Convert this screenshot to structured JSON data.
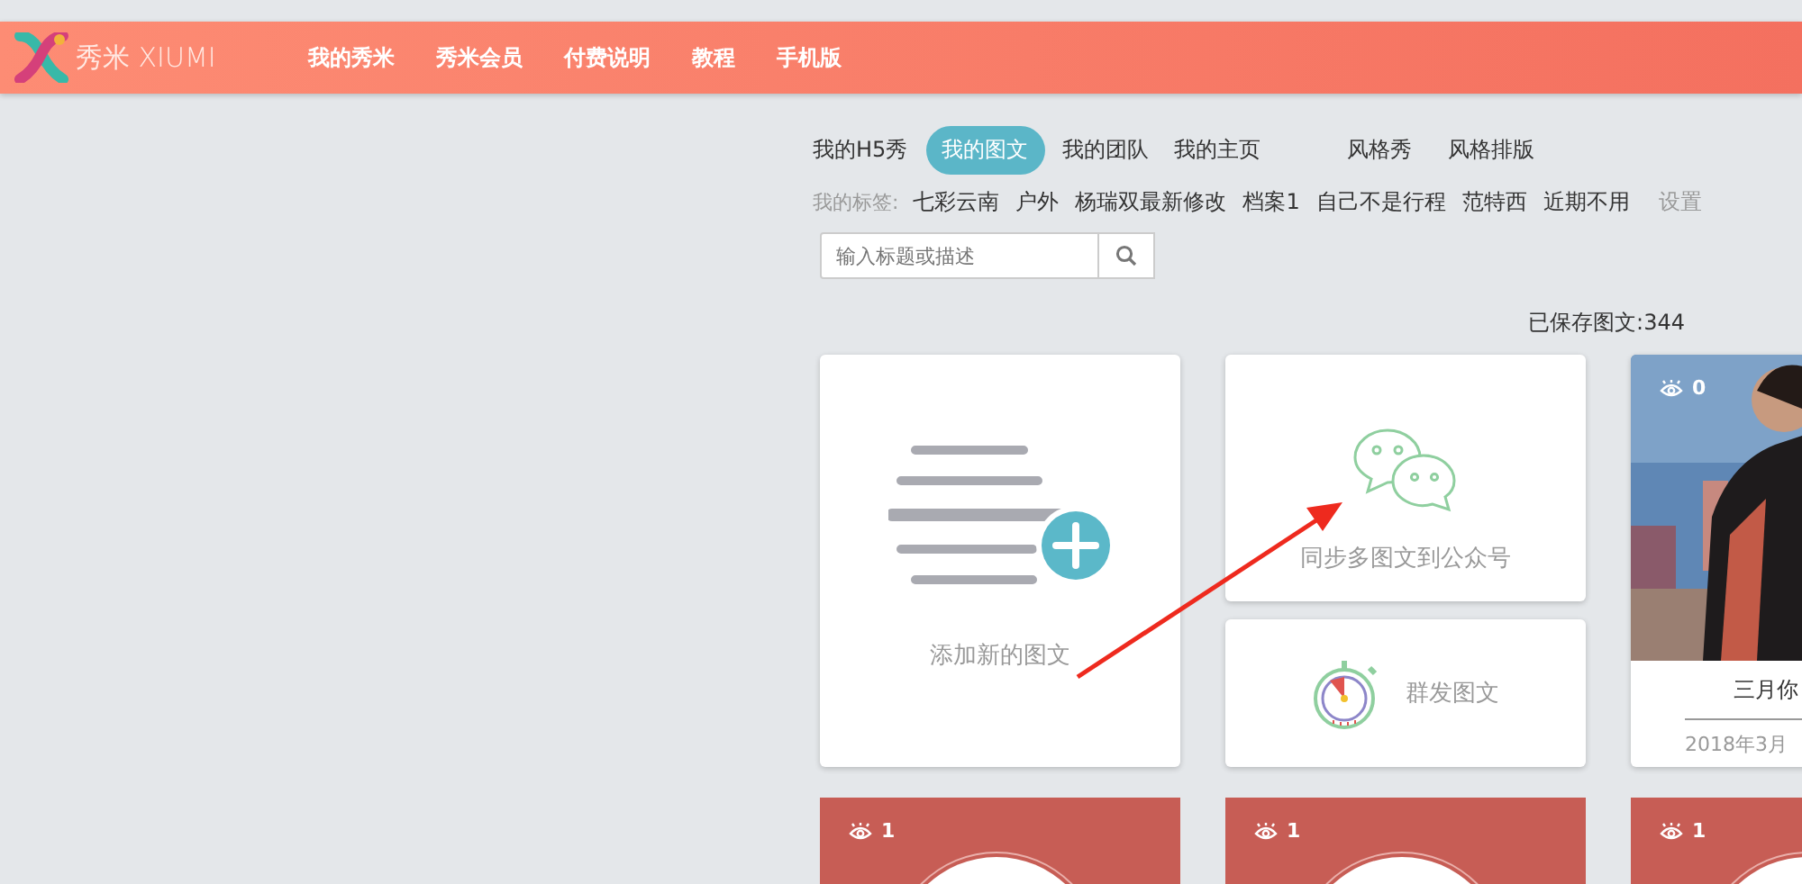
{
  "header": {
    "logo": "秀米 XIUMI",
    "nav": [
      "我的秀米",
      "秀米会员",
      "付费说明",
      "教程",
      "手机版"
    ]
  },
  "tabs": [
    {
      "label": "我的H5秀",
      "selected": false
    },
    {
      "label": "我的图文",
      "selected": true
    },
    {
      "label": "我的团队",
      "selected": false
    },
    {
      "label": "我的主页",
      "selected": false
    }
  ],
  "style_links": [
    "风格秀",
    "风格排版"
  ],
  "tags": {
    "label": "我的标签:",
    "items": [
      "七彩云南",
      "户外",
      "杨瑞双最新修改",
      "档案1",
      "自己不是行程",
      "范特西",
      "近期不用"
    ],
    "settings": "设置"
  },
  "search": {
    "placeholder": "输入标题或描述"
  },
  "saved_count": "已保存图文:344",
  "actions": [
    {
      "kind": "add",
      "label": "添加新的图文"
    },
    {
      "kind": "sync",
      "label": "同步多图文到公众号"
    },
    {
      "kind": "broadcast",
      "label": "群发图文"
    }
  ],
  "articles": [
    {
      "kind": "picture",
      "views": "0",
      "title": "三月你",
      "date": "2018年3月"
    }
  ],
  "bottom_cards": [
    {
      "views": "1"
    },
    {
      "views": "1"
    },
    {
      "views": "1"
    }
  ],
  "annotation": {
    "kind": "arrow"
  }
}
